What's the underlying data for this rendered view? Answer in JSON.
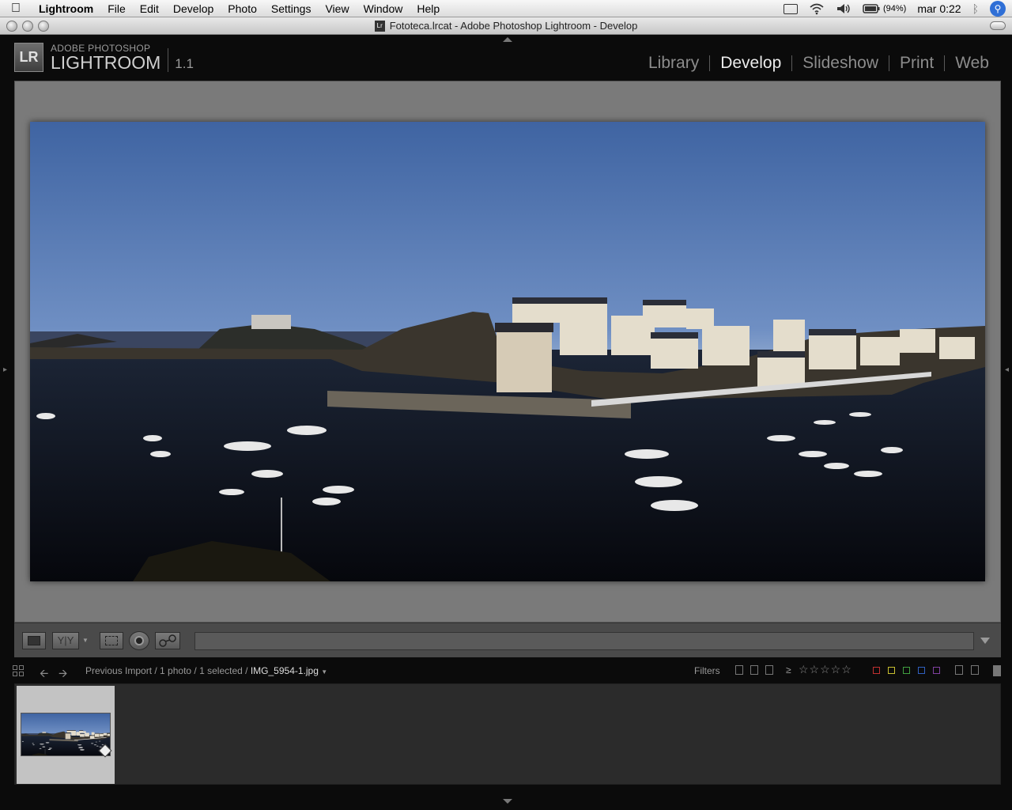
{
  "menubar": {
    "app": "Lightroom",
    "items": [
      "File",
      "Edit",
      "Develop",
      "Photo",
      "Settings",
      "View",
      "Window",
      "Help"
    ],
    "battery": "(94%)",
    "clock": "mar 0:22"
  },
  "window": {
    "title": "Fototeca.lrcat - Adobe Photoshop Lightroom - Develop"
  },
  "identity": {
    "badge": "LR",
    "line1": "ADOBE PHOTOSHOP",
    "line2": "LIGHTROOM",
    "version": "1.1"
  },
  "modules": {
    "items": [
      "Library",
      "Develop",
      "Slideshow",
      "Print",
      "Web"
    ],
    "active": "Develop"
  },
  "filmnav": {
    "source": "Previous Import",
    "count": "1 photo",
    "selected": "1 selected",
    "filename": "IMG_5954-1.jpg",
    "filters_label": "Filters",
    "rating_op": "≥",
    "stars": "☆☆☆☆☆"
  },
  "colors": {
    "accent_labels": [
      "#c03030",
      "#c8c030",
      "#40a040",
      "#3060c0",
      "#8040a0"
    ]
  },
  "icons": {
    "apple": "apple-icon",
    "wifi": "wifi-icon",
    "volume": "volume-icon",
    "battery": "battery-icon",
    "bluetooth": "bluetooth-icon",
    "spotlight": "spotlight-icon"
  }
}
